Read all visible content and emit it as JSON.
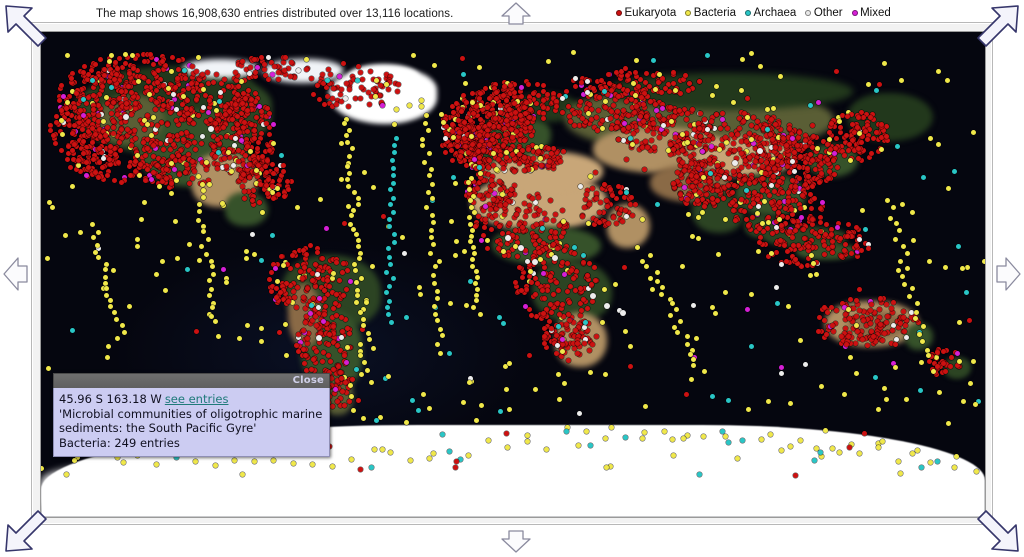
{
  "header": {
    "summary_text": "The map shows 16,908,630 entries distributed over 13,116 locations.",
    "entries_count": "16,908,630",
    "locations_count": "13,116"
  },
  "legend": {
    "items": [
      {
        "label": "Eukaryota",
        "color": "#cc1111"
      },
      {
        "label": "Bacteria",
        "color": "#f0e84a"
      },
      {
        "label": "Archaea",
        "color": "#29c6c6"
      },
      {
        "label": "Other",
        "color": "#e8e8e8"
      },
      {
        "label": "Mixed",
        "color": "#d61fd6"
      }
    ]
  },
  "popup": {
    "close_label": "Close",
    "coords": "45.96 S 163.18 W",
    "link_label": "see entries",
    "study_title": "'Microbial communities of oligotrophic marine sediments: the South Pacific Gyre'",
    "count_line": "Bacteria: 249 entries"
  },
  "nav": {
    "up_left": "pan-up-left",
    "up": "pan-up",
    "up_right": "pan-up-right",
    "left": "pan-left",
    "right": "pan-right",
    "down_left": "pan-down-left",
    "down": "pan-down",
    "down_right": "pan-down-right"
  },
  "map": {
    "background_color": "#04050e",
    "ice_color": "#ffffff",
    "projection_note": "world-equirectangular"
  }
}
